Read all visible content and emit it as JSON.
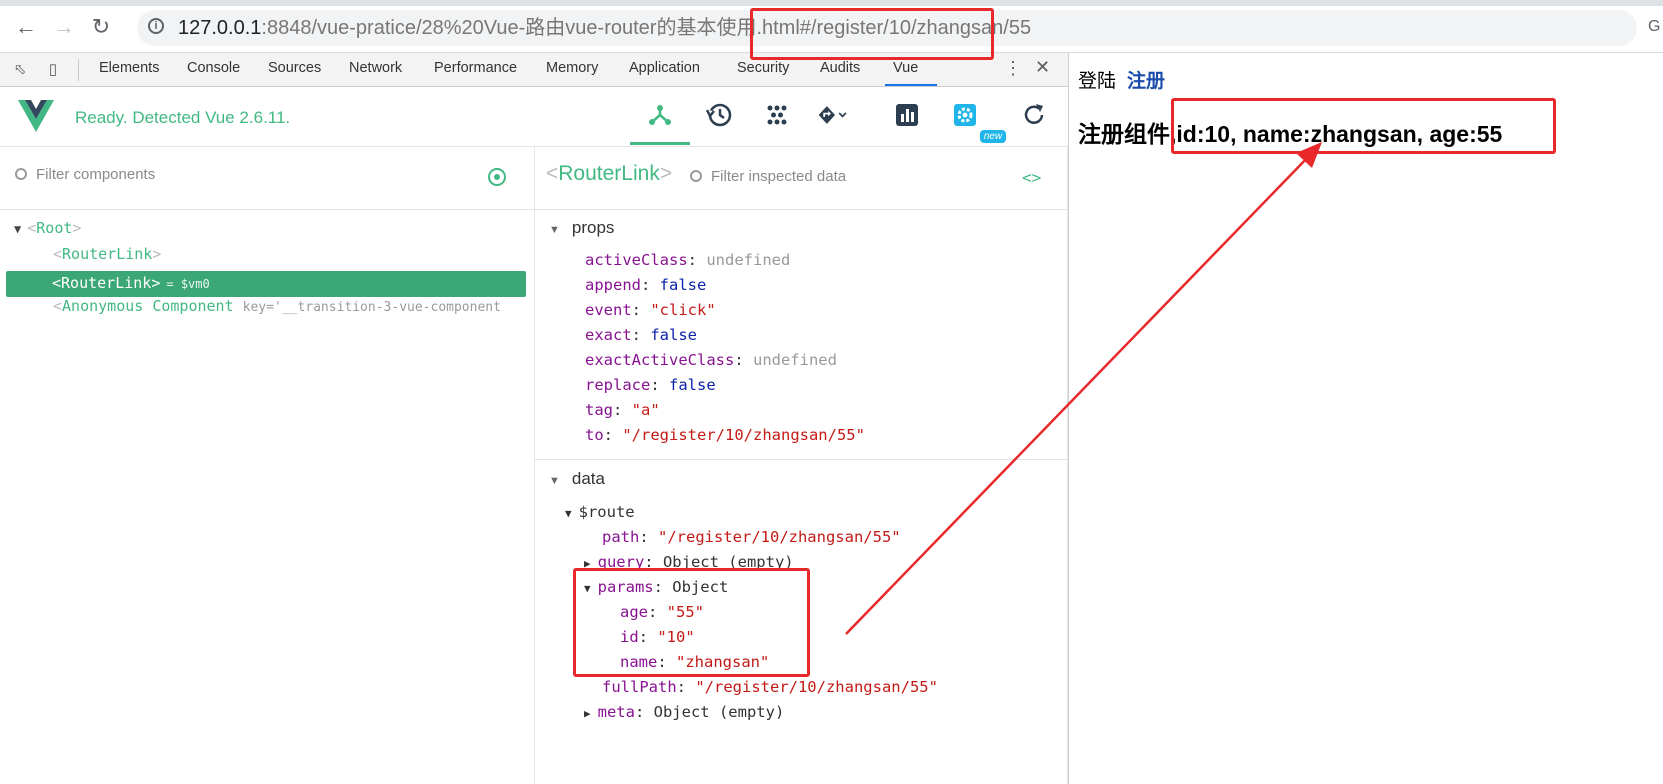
{
  "browser": {
    "url_host": "127.0.0.1",
    "url_rest": ":8848/vue-pratice/28%20Vue-路由vue-router的基本使用.html",
    "url_hash": "#/register/10/zhangsan/55"
  },
  "devtools": {
    "tabs": [
      "Elements",
      "Console",
      "Sources",
      "Network",
      "Performance",
      "Memory",
      "Application",
      "Security",
      "Audits",
      "Vue"
    ],
    "active_tab": "Vue"
  },
  "vue": {
    "status": "Ready. Detected Vue 2.6.11.",
    "new_badge": "new",
    "colors": {
      "accent": "#42b983",
      "selected": "#3ba776"
    }
  },
  "components": {
    "filter_placeholder": "Filter components",
    "tree": [
      {
        "name": "Root",
        "expanded": true
      },
      {
        "name": "RouterLink"
      },
      {
        "name": "RouterLink",
        "selected": true,
        "ref": "= $vm0"
      },
      {
        "name": "Anonymous Component",
        "key": "key='__transition-3-vue-component"
      }
    ]
  },
  "inspector": {
    "component_name": "RouterLink",
    "filter_placeholder": "Filter inspected data",
    "props_title": "props",
    "props": [
      {
        "key": "activeClass",
        "value": "undefined",
        "type": "undefined"
      },
      {
        "key": "append",
        "value": "false",
        "type": "bool"
      },
      {
        "key": "event",
        "value": "\"click\"",
        "type": "string"
      },
      {
        "key": "exact",
        "value": "false",
        "type": "bool"
      },
      {
        "key": "exactActiveClass",
        "value": "undefined",
        "type": "undefined"
      },
      {
        "key": "replace",
        "value": "false",
        "type": "bool"
      },
      {
        "key": "tag",
        "value": "\"a\"",
        "type": "string"
      },
      {
        "key": "to",
        "value": "\"/register/10/zhangsan/55\"",
        "type": "string"
      }
    ],
    "data_title": "data",
    "route": {
      "label": "$route",
      "path_key": "path",
      "path_val": "\"/register/10/zhangsan/55\"",
      "query_key": "query",
      "query_val": "Object (empty)",
      "params_key": "params",
      "params_val": "Object",
      "params": [
        {
          "key": "age",
          "value": "\"55\""
        },
        {
          "key": "id",
          "value": "\"10\""
        },
        {
          "key": "name",
          "value": "\"zhangsan\""
        }
      ],
      "fullpath_key": "fullPath",
      "fullpath_val": "\"/register/10/zhangsan/55\"",
      "meta_key": "meta",
      "meta_val": "Object (empty)"
    }
  },
  "page": {
    "login_link": "登陆",
    "register_link": "注册",
    "register_component_text": "注册组件,id:10, name:zhangsan, age:55"
  },
  "annotation_color": "#e8282b"
}
